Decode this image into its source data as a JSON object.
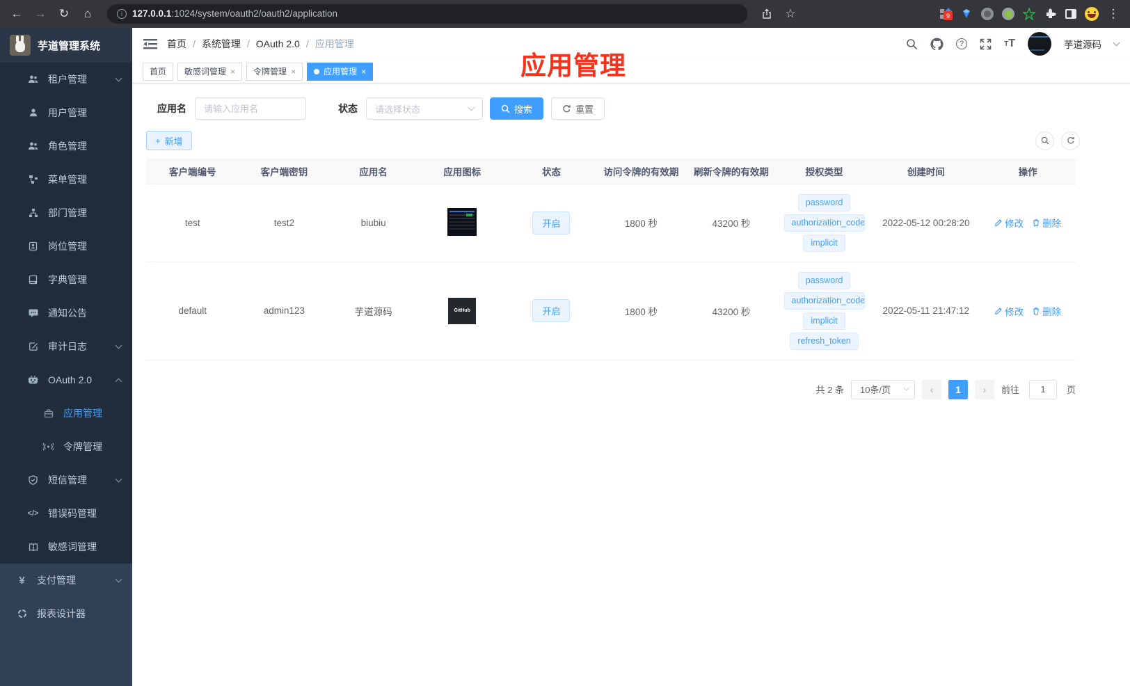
{
  "browser": {
    "url_host": "127.0.0.1",
    "url_rest": ":1024/system/oauth2/oauth2/application",
    "extension_badge": "9"
  },
  "glyphs": {
    "back": "←",
    "forward": "→",
    "reload": "↻",
    "home": "⌂",
    "info": "i",
    "star": "☆",
    "more": "⋮",
    "close": "×",
    "question": "?",
    "t": "T",
    "prev": "‹",
    "next": "›",
    "plus": "+",
    "pay": "¥",
    "code": "</>"
  },
  "colors": {
    "accent": "#409eff",
    "annotation": "#f5321c",
    "tag_bg": "#ecf5ff",
    "sidebar_bg": "#304156",
    "submenu_bg": "#1f2d3d"
  },
  "sidebar": {
    "title": "芋道管理系统",
    "items": [
      {
        "label": "租户管理"
      },
      {
        "label": "用户管理"
      },
      {
        "label": "角色管理"
      },
      {
        "label": "菜单管理"
      },
      {
        "label": "部门管理"
      },
      {
        "label": "岗位管理"
      },
      {
        "label": "字典管理"
      },
      {
        "label": "通知公告"
      },
      {
        "label": "审计日志"
      },
      {
        "label": "OAuth 2.0"
      },
      {
        "label": "应用管理"
      },
      {
        "label": "令牌管理"
      },
      {
        "label": "短信管理"
      },
      {
        "label": "错误码管理"
      },
      {
        "label": "敏感词管理"
      },
      {
        "label": "支付管理"
      },
      {
        "label": "报表设计器"
      }
    ]
  },
  "header": {
    "breadcrumb": [
      "首页",
      "系统管理",
      "OAuth 2.0",
      "应用管理"
    ],
    "sep": "/",
    "username": "芋道源码"
  },
  "tabs": [
    {
      "label": "首页"
    },
    {
      "label": "敏感词管理"
    },
    {
      "label": "令牌管理"
    },
    {
      "label": "应用管理"
    }
  ],
  "annotation": "应用管理",
  "filters": {
    "name_label": "应用名",
    "name_placeholder": "请输入应用名",
    "status_label": "状态",
    "status_placeholder": "请选择状态",
    "search_label": "搜索",
    "reset_label": "重置"
  },
  "toolbar": {
    "add_label": "新增"
  },
  "table": {
    "columns": [
      "客户端编号",
      "客户端密钥",
      "应用名",
      "应用图标",
      "状态",
      "访问令牌的有效期",
      "刷新令牌的有效期",
      "授权类型",
      "创建时间",
      "操作"
    ],
    "edit_label": "修改",
    "delete_label": "删除",
    "row2_icon_text": "GitHub",
    "rows": [
      {
        "client_id": "test",
        "secret": "test2",
        "name": "biubiu",
        "status": "开启",
        "access_token_validity": "1800 秒",
        "refresh_token_validity": "43200 秒",
        "grant_types": [
          "password",
          "authorization_code",
          "implicit"
        ],
        "create_time": "2022-05-12 00:28:20"
      },
      {
        "client_id": "default",
        "secret": "admin123",
        "name": "芋道源码",
        "status": "开启",
        "access_token_validity": "1800 秒",
        "refresh_token_validity": "43200 秒",
        "grant_types": [
          "password",
          "authorization_code",
          "implicit",
          "refresh_token"
        ],
        "create_time": "2022-05-11 21:47:12"
      }
    ]
  },
  "pagination": {
    "total_text": "共 2 条",
    "page_size": "10条/页",
    "current_page": "1",
    "goto_label": "前往",
    "goto_value": "1",
    "goto_unit": "页"
  }
}
